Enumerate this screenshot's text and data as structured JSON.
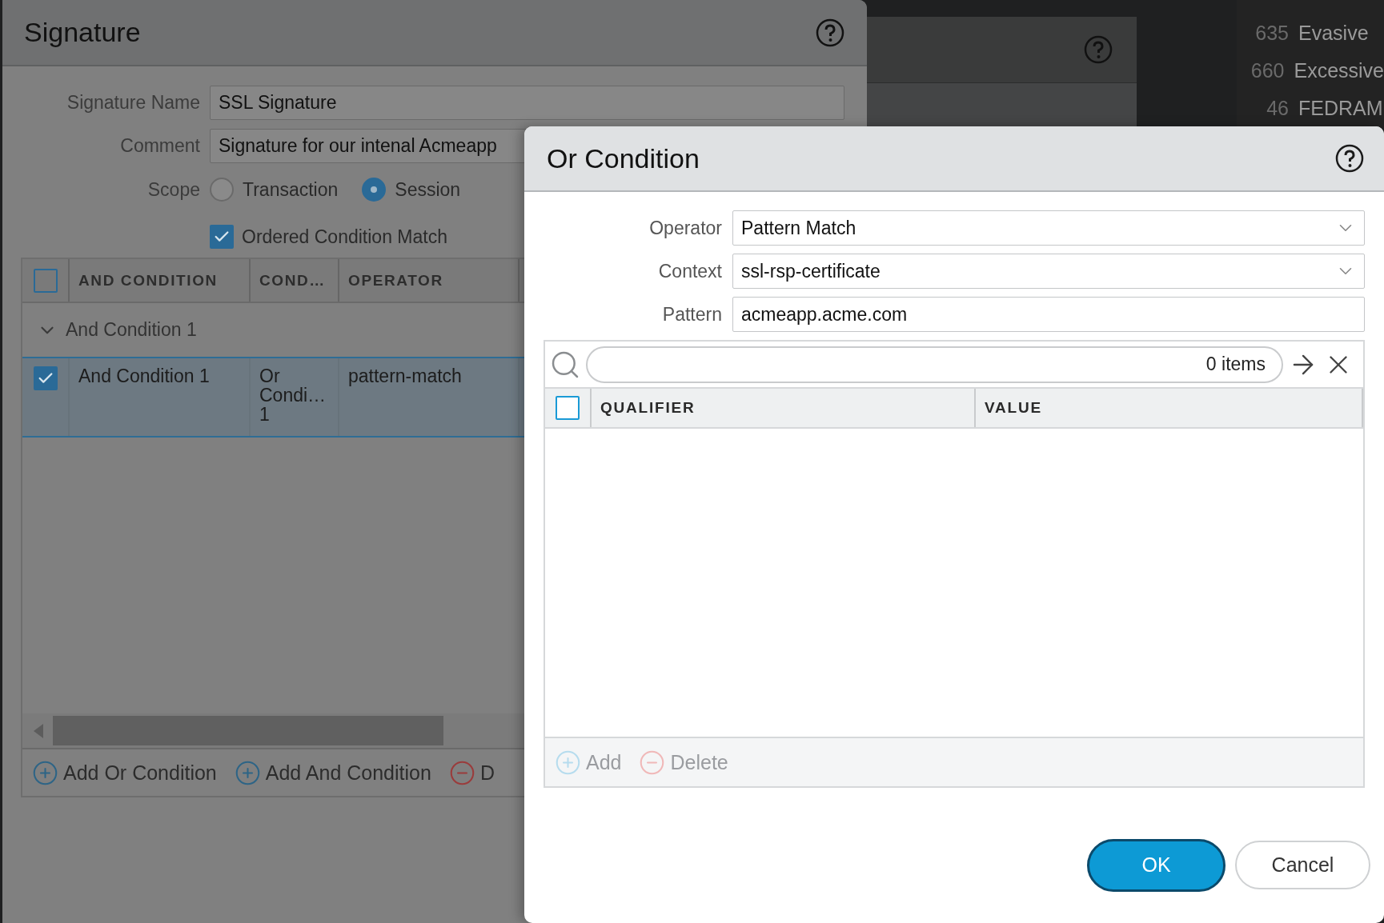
{
  "background_list": [
    {
      "count": "635",
      "name": "Evasive"
    },
    {
      "count": "660",
      "name": "Excessive"
    },
    {
      "count": "46",
      "name": "FEDRAM"
    }
  ],
  "signature_dialog": {
    "title": "Signature",
    "fields": [
      {
        "label": "Signature Name",
        "value": "SSL Signature"
      },
      {
        "label": "Comment",
        "value": "Signature for our intenal Acmeapp"
      }
    ],
    "scope": {
      "label": "Scope",
      "options": [
        {
          "label": "Transaction",
          "selected": false
        },
        {
          "label": "Session",
          "selected": true
        }
      ]
    },
    "ordered_match": {
      "label": "Ordered Condition Match",
      "checked": true
    },
    "table": {
      "columns": [
        "AND CONDITION",
        "COND…",
        "OPERATOR"
      ],
      "header_checked": false,
      "groups": [
        {
          "label": "And Condition 1",
          "expanded": true,
          "rows": [
            {
              "cells": [
                "And Condition 1",
                "Or Condi… 1",
                "pattern-match"
              ],
              "checked": true,
              "selected": true
            }
          ]
        }
      ]
    },
    "actions": [
      {
        "kind": "add",
        "label": "Add Or Condition"
      },
      {
        "kind": "add",
        "label": "Add And Condition"
      },
      {
        "kind": "delete",
        "label": "D"
      }
    ]
  },
  "or_condition_dialog": {
    "title": "Or Condition",
    "fields": [
      {
        "kind": "select",
        "label": "Operator",
        "value": "Pattern Match"
      },
      {
        "kind": "select",
        "label": "Context",
        "value": "ssl-rsp-certificate"
      },
      {
        "kind": "text",
        "label": "Pattern",
        "value": "acmeapp.acme.com"
      }
    ],
    "search": {
      "count": "0 items"
    },
    "table": {
      "columns": [
        "QUALIFIER",
        "VALUE"
      ],
      "header_checked": false
    },
    "actions": [
      {
        "kind": "add",
        "label": "Add",
        "disabled": true
      },
      {
        "kind": "delete",
        "label": "Delete",
        "disabled": true
      }
    ],
    "buttons": [
      {
        "kind": "primary",
        "label": "OK"
      },
      {
        "kind": "secondary",
        "label": "Cancel"
      }
    ]
  }
}
